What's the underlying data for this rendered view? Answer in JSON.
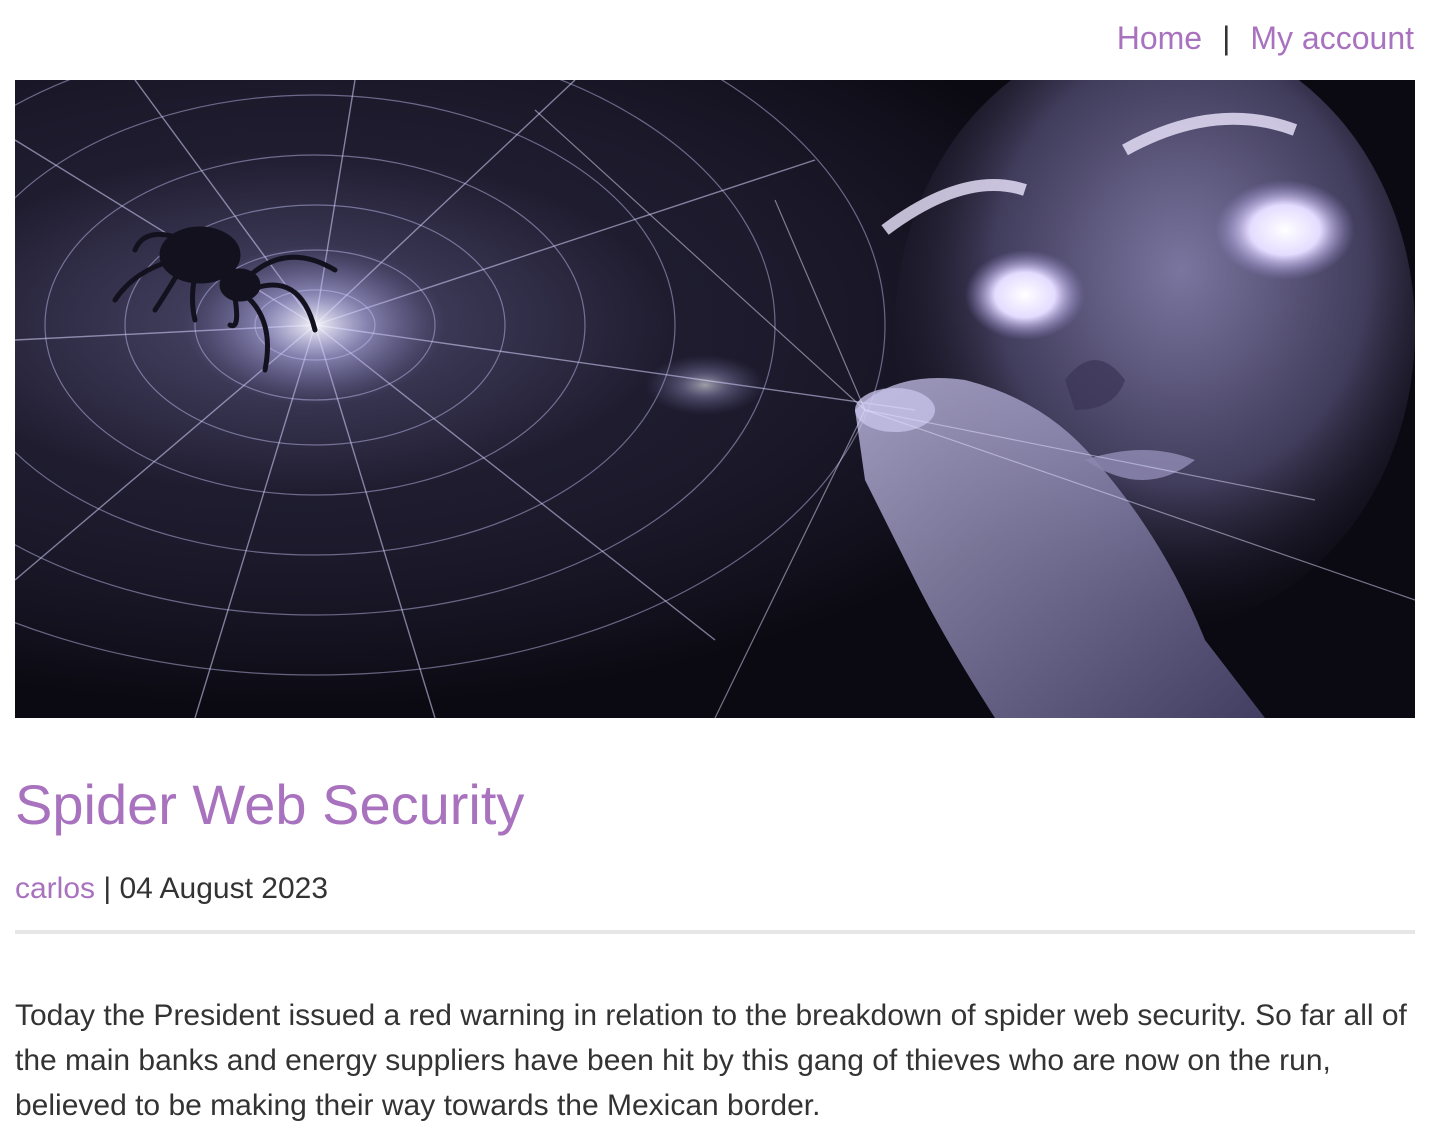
{
  "nav": {
    "home_label": "Home",
    "separator": "|",
    "account_label": "My account"
  },
  "hero": {
    "description": "spider-web-security-hero-image"
  },
  "post": {
    "title": "Spider Web Security",
    "author": "carlos",
    "meta_separator": " | ",
    "date": "04 August 2023",
    "body": "Today the President issued a red warning in relation to the breakdown of spider web security. So far all of the main banks and energy suppliers have been hit by this gang of thieves who are now on the run, believed to be making their way towards the Mexican border."
  },
  "colors": {
    "accent": "#a972bf",
    "text": "#333333",
    "divider": "#e6e6e6"
  }
}
